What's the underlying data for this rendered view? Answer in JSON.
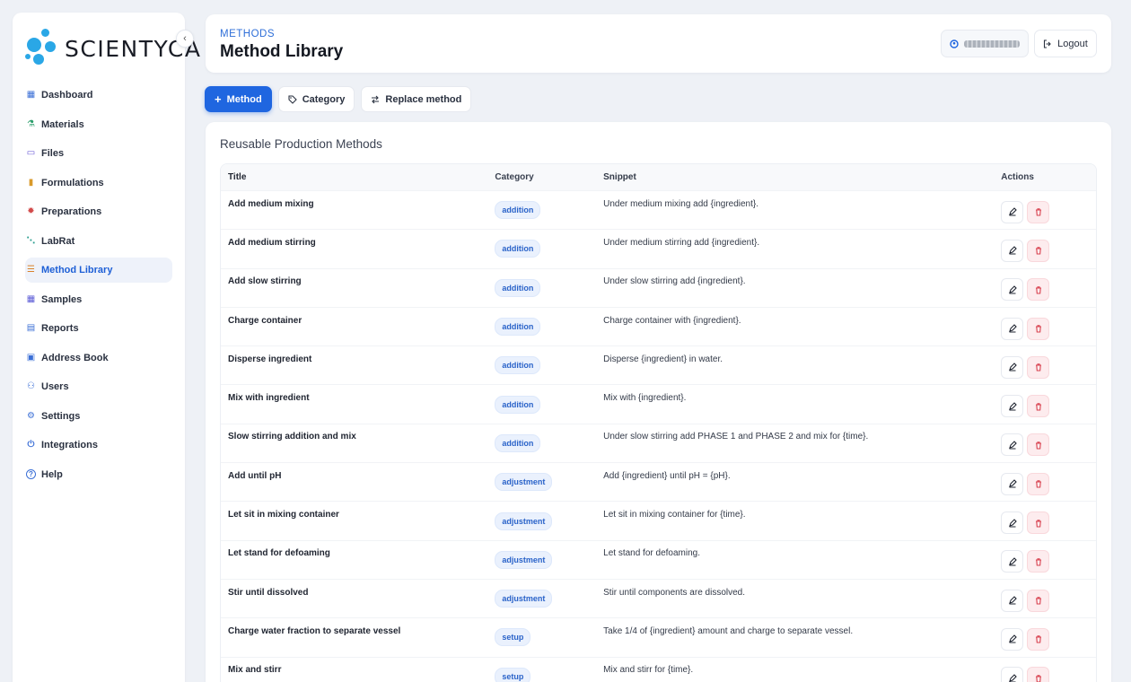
{
  "brand": {
    "name": "SCIENTYCA",
    "collapse_icon": "chevron-left-icon",
    "accent": "#2aa7e6"
  },
  "sidebar": {
    "items": [
      {
        "label": "Dashboard",
        "icon": "dashboard-icon",
        "color": "#3b6fd6",
        "active": false
      },
      {
        "label": "Materials",
        "icon": "flask-icon",
        "color": "#2a9d6a",
        "active": false
      },
      {
        "label": "Files",
        "icon": "folder-icon",
        "color": "#6b5bd6",
        "active": false
      },
      {
        "label": "Formulations",
        "icon": "test-tube-icon",
        "color": "#d99a2b",
        "active": false
      },
      {
        "label": "Preparations",
        "icon": "virus-icon",
        "color": "#d24a4a",
        "active": false
      },
      {
        "label": "LabRat",
        "icon": "share-icon",
        "color": "#2a9d8f",
        "active": false
      },
      {
        "label": "Method Library",
        "icon": "checklist-icon",
        "color": "#d9822b",
        "active": true
      },
      {
        "label": "Samples",
        "icon": "grid-icon",
        "color": "#5b5bd6",
        "active": false
      },
      {
        "label": "Reports",
        "icon": "report-icon",
        "color": "#3b6fd6",
        "active": false
      },
      {
        "label": "Address Book",
        "icon": "book-icon",
        "color": "#3b6fd6",
        "active": false
      },
      {
        "label": "Users",
        "icon": "users-icon",
        "color": "#3b6fd6",
        "active": false
      },
      {
        "label": "Settings",
        "icon": "gear-icon",
        "color": "#3b6fd6",
        "active": false
      },
      {
        "label": "Integrations",
        "icon": "plug-icon",
        "color": "#3b6fd6",
        "active": false
      },
      {
        "label": "Help",
        "icon": "help-icon",
        "color": "#3b6fd6",
        "active": false
      }
    ]
  },
  "header": {
    "breadcrumb": "METHODS",
    "title": "Method Library",
    "logout_label": "Logout"
  },
  "toolbar": {
    "method_label": "Method",
    "category_label": "Category",
    "replace_label": "Replace method"
  },
  "table": {
    "title": "Reusable Production Methods",
    "columns": [
      "Title",
      "Category",
      "Snippet",
      "Actions"
    ],
    "rows": [
      {
        "title": "Add medium mixing",
        "category": "addition",
        "snippet": "Under medium mixing add {ingredient}."
      },
      {
        "title": "Add medium stirring",
        "category": "addition",
        "snippet": "Under medium stirring add {ingredient}."
      },
      {
        "title": "Add slow stirring",
        "category": "addition",
        "snippet": "Under slow stirring add {ingredient}."
      },
      {
        "title": "Charge container",
        "category": "addition",
        "snippet": "Charge container with {ingredient}."
      },
      {
        "title": "Disperse ingredient",
        "category": "addition",
        "snippet": "Disperse {ingredient} in water."
      },
      {
        "title": "Mix with ingredient",
        "category": "addition",
        "snippet": "Mix with {ingredient}."
      },
      {
        "title": "Slow stirring addition and mix",
        "category": "addition",
        "snippet": "Under slow stirring add PHASE 1 and PHASE 2 and mix for {time}."
      },
      {
        "title": "Add until pH",
        "category": "adjustment",
        "snippet": "Add {ingredient} until pH = {pH}."
      },
      {
        "title": "Let sit in mixing container",
        "category": "adjustment",
        "snippet": "Let sit in mixing container for {time}."
      },
      {
        "title": "Let stand for defoaming",
        "category": "adjustment",
        "snippet": "Let stand for defoaming."
      },
      {
        "title": "Stir until dissolved",
        "category": "adjustment",
        "snippet": "Stir until components are dissolved."
      },
      {
        "title": "Charge water fraction to separate vessel",
        "category": "setup",
        "snippet": "Take 1/4 of {ingredient} amount and charge to separate vessel."
      },
      {
        "title": "Mix and stirr",
        "category": "setup",
        "snippet": "Mix and stirr for {time}."
      }
    ]
  }
}
